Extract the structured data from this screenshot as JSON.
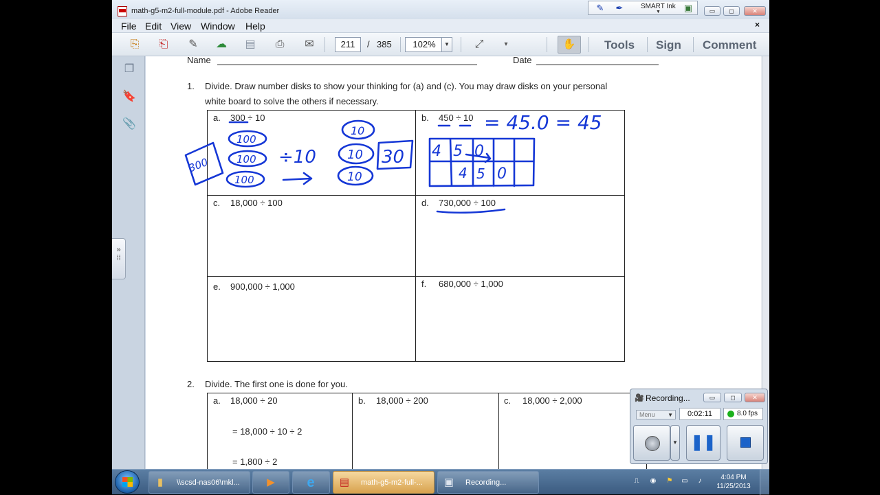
{
  "window": {
    "title": "math-g5-m2-full-module.pdf - Adobe Reader",
    "minimize": "▭",
    "maximize": "◻",
    "close": "✕",
    "doc_close": "×"
  },
  "smart_ink": {
    "label": "SMART Ink",
    "icons": [
      "pen-icon",
      "pen-settings-icon",
      "eraser-icon"
    ]
  },
  "menu": {
    "file": "File",
    "edit": "Edit",
    "view": "View",
    "window": "Window",
    "help": "Help"
  },
  "toolbar": {
    "page_current": "211",
    "page_separator": "/",
    "page_total": "385",
    "zoom": "102%",
    "tools": "Tools",
    "sign": "Sign",
    "comment": "Comment"
  },
  "document": {
    "name_label": "Name",
    "date_label": "Date",
    "q1_number": "1.",
    "q1_text_line1": "Divide.  Draw number disks to show your thinking for (a) and (c).  You may draw disks on your personal",
    "q1_text_line2": "white board to solve the others if necessary.",
    "q1_items": [
      {
        "letter": "a.",
        "expr": "300 ÷ 10"
      },
      {
        "letter": "b.",
        "expr": "450 ÷ 10"
      },
      {
        "letter": "c.",
        "expr": "18,000 ÷ 100"
      },
      {
        "letter": "d.",
        "expr": "730,000 ÷ 100"
      },
      {
        "letter": "e.",
        "expr": "900,000 ÷ 1,000"
      },
      {
        "letter": "f.",
        "expr": "680,000 ÷ 1,000"
      }
    ],
    "q2_number": "2.",
    "q2_text": "Divide.  The first one is done for you.",
    "q2_items": [
      {
        "letter": "a.",
        "expr": "18,000 ÷ 20"
      },
      {
        "letter": "b.",
        "expr": "18,000 ÷ 200"
      },
      {
        "letter": "c.",
        "expr": "18,000 ÷ 2,000"
      }
    ],
    "q2a_step1": "= 18,000 ÷ 10 ÷ 2",
    "q2a_step2": "= 1,800 ÷ 2"
  },
  "ink": {
    "color": "#1537d6",
    "disk_100": "100",
    "disk_10": "10",
    "divide_sign": "÷10",
    "result_a": "300",
    "result_a2": "30",
    "b_equation": "= 45.0 = 45",
    "b_chart_top": [
      "4",
      "5",
      "0"
    ],
    "b_chart_bottom": [
      "4",
      "5",
      "0"
    ]
  },
  "recorder": {
    "title": "Recording...",
    "menu": "Menu",
    "time": "0:02:11",
    "fps": "8.0 fps",
    "status_color": "#1bb01b"
  },
  "taskbar": {
    "items": [
      {
        "label": "\\\\scsd-nas06\\mkl...",
        "icon": "folder-icon"
      },
      {
        "label": "",
        "icon": "media-player-icon"
      },
      {
        "label": "",
        "icon": "internet-explorer-icon"
      },
      {
        "label": "math-g5-m2-full-...",
        "icon": "pdf-icon"
      },
      {
        "label": "Recording...",
        "icon": "recorder-icon"
      }
    ],
    "time": "4:04 PM",
    "date": "11/25/2013"
  }
}
